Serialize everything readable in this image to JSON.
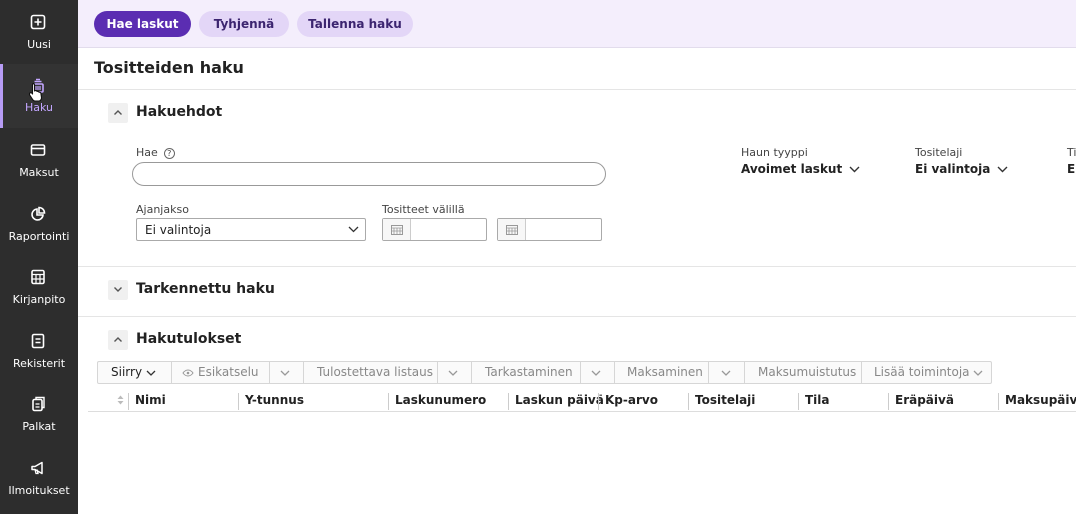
{
  "sidebar": {
    "items": [
      {
        "label": "Uusi",
        "icon": "plus-square-icon"
      },
      {
        "label": "Haku",
        "icon": "stack-icon",
        "active": true
      },
      {
        "label": "Maksut",
        "icon": "card-icon"
      },
      {
        "label": "Raportointi",
        "icon": "pie-chart-icon"
      },
      {
        "label": "Kirjanpito",
        "icon": "calculator-icon"
      },
      {
        "label": "Rekisterit",
        "icon": "register-icon"
      },
      {
        "label": "Palkat",
        "icon": "wage-icon"
      },
      {
        "label": "Ilmoitukset",
        "icon": "megaphone-icon"
      }
    ],
    "accent": "#b79cf5"
  },
  "toolbar": {
    "search_label": "Hae laskut",
    "clear_label": "Tyhjennä",
    "save_label": "Tallenna haku",
    "primary_color": "#5b2db2",
    "secondary_color": "#e3d6f7"
  },
  "page": {
    "title": "Tositteiden haku"
  },
  "criteria": {
    "title": "Hakuehdot",
    "search_label": "Hae",
    "search_value": "",
    "period_label": "Ajanjakso",
    "period_value": "Ei valintoja",
    "between_label": "Tositteet välillä",
    "search_type_label": "Haun tyyppi",
    "search_type_value": "Avoimet laskut",
    "doc_type_label": "Tositelaji",
    "doc_type_value": "Ei valintoja",
    "cut_label": "Ti",
    "cut_value": "Ei"
  },
  "advanced": {
    "title": "Tarkennettu haku"
  },
  "results": {
    "title": "Hakutulokset",
    "actions": {
      "move": "Siirry",
      "preview": "Esikatselu",
      "print_list": "Tulostettava listaus",
      "review": "Tarkastaminen",
      "payment": "Maksaminen",
      "reminder": "Maksumuistutus",
      "more": "Lisää toimintoja"
    },
    "columns": [
      "Nimi",
      "Y-tunnus",
      "Laskunumero",
      "Laskun päivä",
      "Kp-arvo",
      "Tositelaji",
      "Tila",
      "Eräpäivä",
      "Maksupäivä"
    ]
  }
}
